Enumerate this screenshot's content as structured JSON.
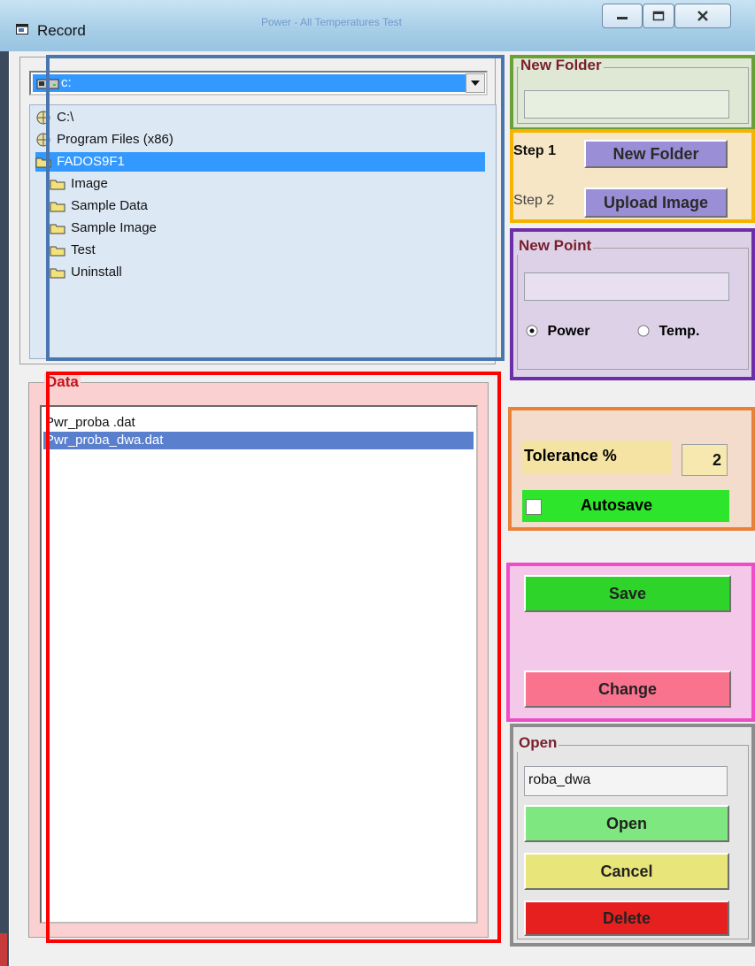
{
  "window": {
    "title": "Record",
    "background_title": "Power - All Temperatures Test"
  },
  "drive": {
    "selected": "c:"
  },
  "tree": {
    "items": [
      {
        "label": "C:\\",
        "type": "open-folder"
      },
      {
        "label": "Program Files (x86)",
        "type": "open-folder"
      },
      {
        "label": "FADOS9F1",
        "type": "open-folder",
        "selected": true
      },
      {
        "label": "Image",
        "type": "folder"
      },
      {
        "label": "Sample Data",
        "type": "folder"
      },
      {
        "label": "Sample Image",
        "type": "folder"
      },
      {
        "label": "Test",
        "type": "folder"
      },
      {
        "label": "Uninstall",
        "type": "folder"
      }
    ]
  },
  "data_group": {
    "legend": "Data",
    "files": [
      {
        "label": "Pwr_proba .dat",
        "selected": false
      },
      {
        "label": "Pwr_proba_dwa.dat",
        "selected": true
      }
    ]
  },
  "new_folder": {
    "legend": "New Folder",
    "value": ""
  },
  "steps": {
    "step1_label": "Step 1",
    "step1_button": "New Folder",
    "step2_label": "Step 2",
    "step2_button": "Upload Image"
  },
  "new_point": {
    "legend": "New Point",
    "value": "",
    "option_power": "Power",
    "option_temp": "Temp.",
    "selected_option": "Power"
  },
  "tolerance": {
    "label": "Tolerance %",
    "value": "2",
    "autosave_label": "Autosave",
    "autosave_checked": false
  },
  "actions": {
    "save": "Save",
    "change": "Change"
  },
  "open_group": {
    "legend": "Open",
    "value": "roba_dwa",
    "open_button": "Open",
    "cancel_button": "Cancel",
    "delete_button": "Delete"
  },
  "colors": {
    "legend_text": "#7a1f2b",
    "data_legend": "#c0141c",
    "overlay_blue": "#4a76b0",
    "overlay_red": "#ff0000",
    "overlay_green": "#6a9f3a",
    "overlay_yellow": "#f5b400",
    "overlay_purple": "#6b2ea8",
    "overlay_orange": "#e8823a",
    "overlay_pink": "#f04cc8",
    "overlay_gray": "#8c8c8c",
    "btn_purple": "#9a8fd6",
    "btn_green": "#2fd42a",
    "btn_pink": "#f9738f",
    "btn_light_green": "#7fe77f",
    "btn_yellow": "#e8e57a",
    "btn_red": "#e6201f"
  }
}
